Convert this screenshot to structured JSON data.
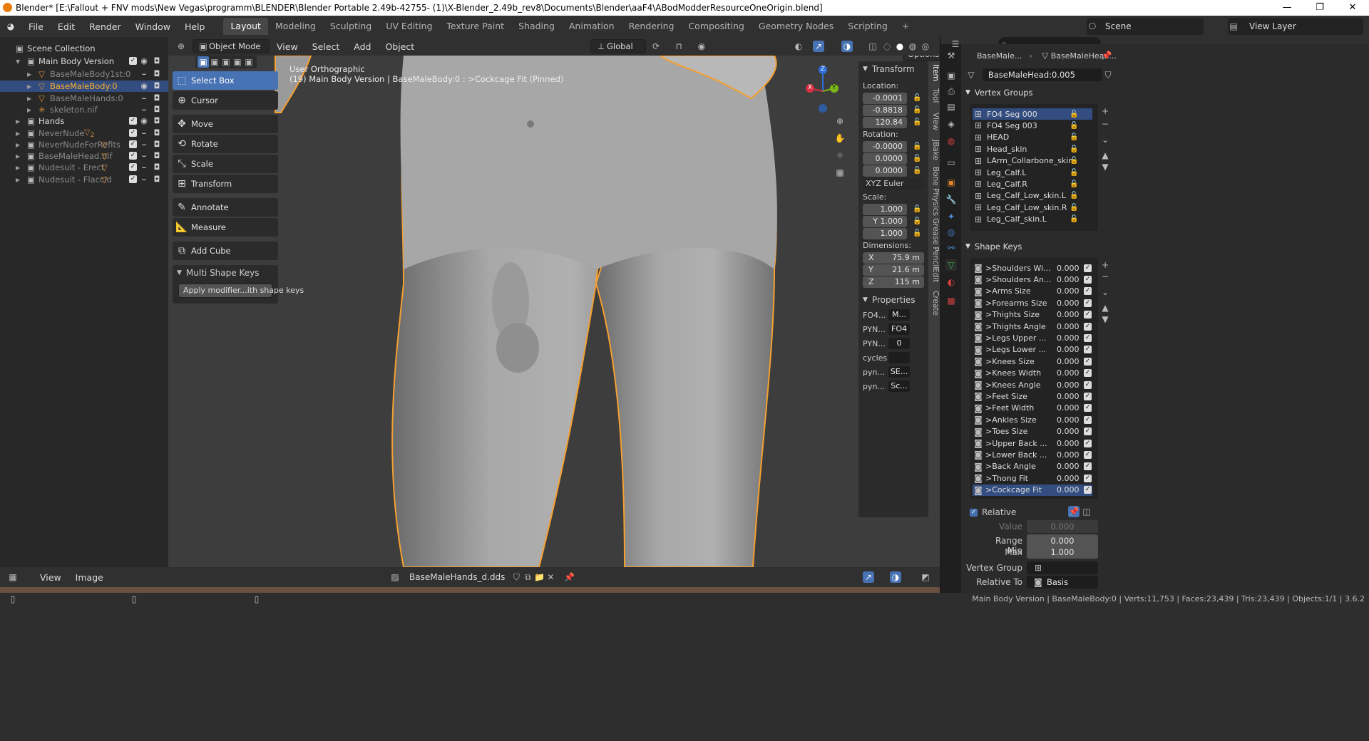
{
  "window": {
    "title": "Blender* [E:\\Fallout + FNV mods\\New Vegas\\programm\\BLENDER\\Blender Portable 2.49b-42755- (1)\\X-Blender_2.49b_rev8\\Documents\\Blender\\aaF4\\ABodModderResourceOneOrigin.blend]",
    "controls": [
      "—",
      "❐",
      "✕"
    ]
  },
  "menubar": {
    "items": [
      "File",
      "Edit",
      "Render",
      "Window",
      "Help"
    ],
    "workspaces": [
      "Layout",
      "Modeling",
      "Sculpting",
      "UV Editing",
      "Texture Paint",
      "Shading",
      "Animation",
      "Rendering",
      "Compositing",
      "Geometry Nodes",
      "Scripting"
    ],
    "active_workspace": "Layout",
    "add_workspace": "+",
    "scene": "Scene",
    "view_layer": "View Layer"
  },
  "outliner": {
    "search_placeholder": "",
    "rows": [
      {
        "label": "Scene Collection",
        "indent": 0
      },
      {
        "label": "Main Body Version",
        "indent": 1
      },
      {
        "label": "BaseMaleBody1st:0",
        "indent": 2
      },
      {
        "label": "BaseMaleBody:0",
        "indent": 2
      },
      {
        "label": "BaseMaleHands:0",
        "indent": 2
      },
      {
        "label": "skeleton.nif",
        "indent": 2
      },
      {
        "label": "Hands",
        "indent": 1
      },
      {
        "label": "NeverNude",
        "indent": 1
      },
      {
        "label": "NeverNudeForRefits",
        "indent": 1
      },
      {
        "label": "BaseMaleHead.nif",
        "indent": 1
      },
      {
        "label": "Nudesuit - Erect",
        "indent": 1
      },
      {
        "label": "Nudesuit - Flaccid",
        "indent": 1
      }
    ],
    "never_nude_badge": "2"
  },
  "viewport_header": {
    "mode": "Object Mode",
    "menus": [
      "View",
      "Select",
      "Add",
      "Object"
    ],
    "orientation": "Global",
    "options": "Options"
  },
  "viewport": {
    "view_name": "User Orthographic",
    "object_info": "(19) Main Body Version | BaseMaleBody:0 : >Cockcage Fit (Pinned)",
    "gizmo": {
      "z": "Z",
      "y": "Y",
      "x": "X"
    }
  },
  "toolbar": {
    "tools": [
      "Select Box",
      "Cursor",
      "Move",
      "Rotate",
      "Scale",
      "Transform",
      "Annotate",
      "Measure",
      "Add Cube"
    ],
    "active": "Select Box",
    "subpanel_title": "Multi Shape Keys",
    "subpanel_button": "Apply modifier...ith shape keys"
  },
  "npanel": {
    "transform_title": "Transform",
    "location_label": "Location:",
    "location": [
      "-0.0001",
      "-0.8818",
      "120.84"
    ],
    "rotation_label": "Rotation:",
    "rotation": [
      "-0.0000",
      "0.0000",
      "0.0000"
    ],
    "rotation_mode": "XYZ Euler",
    "scale_label": "Scale:",
    "scale": [
      "1.000",
      "Y 1.000",
      "1.000"
    ],
    "dimensions_label": "Dimensions:",
    "dimensions": [
      {
        "axis": "X",
        "value": "75.9 m"
      },
      {
        "axis": "Y",
        "value": "21.6 m"
      },
      {
        "axis": "Z",
        "value": "115 m"
      }
    ],
    "properties_title": "Properties",
    "properties": [
      {
        "key": "FO4...",
        "value": "M..."
      },
      {
        "key": "PYN...",
        "value": "FO4"
      },
      {
        "key": "PYN...",
        "value": "0"
      },
      {
        "key": "cycles",
        "value": ""
      },
      {
        "key": "pyn...",
        "value": "SE..."
      },
      {
        "key": "pyn...",
        "value": "Sc..."
      }
    ],
    "tabs": [
      "Item",
      "Tool",
      "View",
      "JBake",
      "Bone Physics",
      "Grease Pencil",
      "Edit",
      "Create"
    ]
  },
  "properties": {
    "breadcrumb": [
      "BaseMale...",
      "BaseMaleHead..."
    ],
    "data_name": "BaseMaleHead:0.005",
    "vertex_groups_title": "Vertex Groups",
    "vertex_groups": [
      "FO4 Seg 000",
      "FO4 Seg 003",
      "HEAD",
      "Head_skin",
      "LArm_Collarbone_skin",
      "Leg_Calf.L",
      "Leg_Calf.R",
      "Leg_Calf_Low_skin.L",
      "Leg_Calf_Low_skin.R",
      "Leg_Calf_skin.L"
    ],
    "shape_keys_title": "Shape Keys",
    "shape_keys": [
      {
        "name": ">Shoulders Wi...",
        "value": "0.000"
      },
      {
        "name": ">Shoulders An...",
        "value": "0.000"
      },
      {
        "name": ">Arms Size",
        "value": "0.000"
      },
      {
        "name": ">Forearms Size",
        "value": "0.000"
      },
      {
        "name": ">Thights Size",
        "value": "0.000"
      },
      {
        "name": ">Thights Angle",
        "value": "0.000"
      },
      {
        "name": ">Legs Upper ...",
        "value": "0.000"
      },
      {
        "name": ">Legs Lower ...",
        "value": "0.000"
      },
      {
        "name": ">Knees Size",
        "value": "0.000"
      },
      {
        "name": ">Knees Width",
        "value": "0.000"
      },
      {
        "name": ">Knees Angle",
        "value": "0.000"
      },
      {
        "name": ">Feet Size",
        "value": "0.000"
      },
      {
        "name": ">Feet Width",
        "value": "0.000"
      },
      {
        "name": ">Ankles Size",
        "value": "0.000"
      },
      {
        "name": ">Toes Size",
        "value": "0.000"
      },
      {
        "name": ">Upper Back ...",
        "value": "0.000"
      },
      {
        "name": ">Lower Back ...",
        "value": "0.000"
      },
      {
        "name": ">Back Angle",
        "value": "0.000"
      },
      {
        "name": ">Thong Fit",
        "value": "0.000"
      },
      {
        "name": ">Cockcage Fit",
        "value": "0.000"
      }
    ],
    "relative_label": "Relative",
    "value_label": "Value",
    "value": "0.000",
    "range_min_label": "Range Min",
    "range_min": "0.000",
    "max_label": "Max",
    "max": "1.000",
    "vertex_group_label": "Vertex Group",
    "relative_to_label": "Relative To",
    "relative_to": "Basis"
  },
  "image_editor": {
    "menus": [
      "View",
      "Image"
    ],
    "image_name": "BaseMaleHands_d.dds"
  },
  "statusbar": {
    "info": "Main Body Version | BaseMaleBody:0 | Verts:11,753 | Faces:23,439 | Tris:23,439 | Objects:1/1 | 3.6.2"
  },
  "colors": {
    "accent": "#4772b3",
    "selected_row": "#334d80",
    "outline": "#f5a030",
    "active_object_text": "#ffaf29"
  }
}
